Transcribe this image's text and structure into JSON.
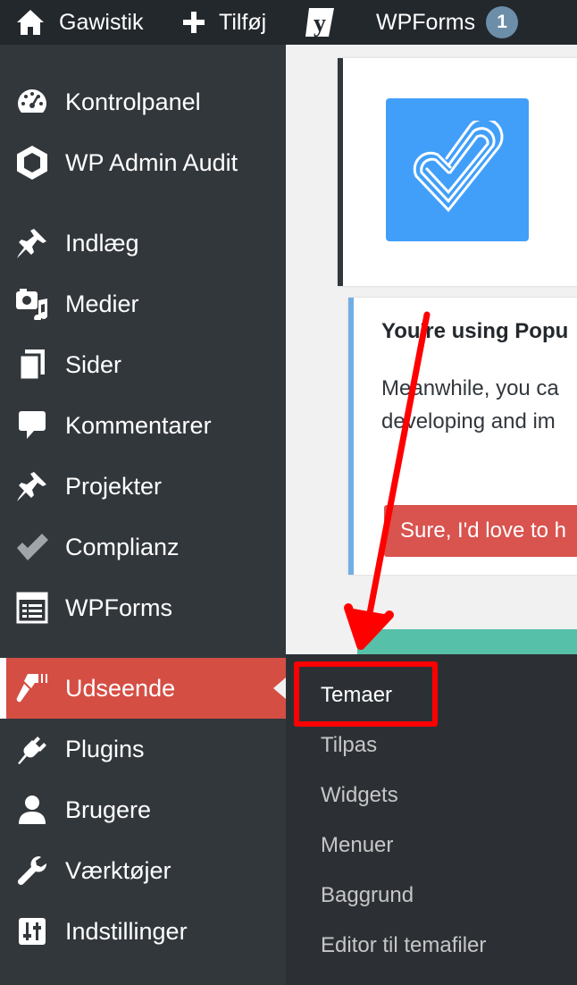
{
  "admin_bar": {
    "site_name": "Gawistik",
    "new_label": "Tilføj",
    "yoast_letter": "y",
    "wpforms_label": "WPForms",
    "wpforms_count": "1"
  },
  "sidebar": {
    "items": [
      {
        "label": "Kontrolpanel",
        "icon": "dashboard-icon"
      },
      {
        "label": "WP Admin Audit",
        "icon": "hexagon-icon"
      },
      {
        "label": "Indlæg",
        "icon": "pushpin-icon"
      },
      {
        "label": "Medier",
        "icon": "media-icon"
      },
      {
        "label": "Sider",
        "icon": "pages-icon"
      },
      {
        "label": "Kommentarer",
        "icon": "comment-icon"
      },
      {
        "label": "Projekter",
        "icon": "pushpin-icon"
      },
      {
        "label": "Complianz",
        "icon": "checkmark-icon"
      },
      {
        "label": "WPForms",
        "icon": "form-icon"
      },
      {
        "label": "Udseende",
        "icon": "paintbrush-icon",
        "current": true
      },
      {
        "label": "Plugins",
        "icon": "plug-icon"
      },
      {
        "label": "Brugere",
        "icon": "user-icon"
      },
      {
        "label": "Værktøjer",
        "icon": "wrench-icon"
      },
      {
        "label": "Indstillinger",
        "icon": "settings-sliders-icon"
      }
    ]
  },
  "submenu": {
    "items": [
      "Temaer",
      "Tilpas",
      "Widgets",
      "Menuer",
      "Baggrund",
      "Editor til temafiler"
    ],
    "highlighted": "Temaer"
  },
  "content": {
    "notice_title": "You're using Popu",
    "notice_body_line1": "Meanwhile, you ca",
    "notice_body_line2": "developing and im",
    "notice_button": "Sure, I'd love to h"
  },
  "colors": {
    "admin_bar_bg": "#23282d",
    "sidebar_bg": "#32373c",
    "current_menu_bg": "#d54e44",
    "logo_blue": "#419ff9",
    "button_red": "#d9534f",
    "green_bar": "#56c0a9",
    "annotation_red": "#ff0000"
  }
}
